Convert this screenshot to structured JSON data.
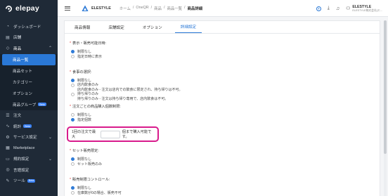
{
  "brand": {
    "name": "elepay"
  },
  "sidebar": {
    "items": [
      {
        "label": "ダッシュボード"
      },
      {
        "label": "店舗"
      },
      {
        "label": "商品"
      },
      {
        "label": "注文"
      },
      {
        "label": "統計",
        "badge": "Beta"
      },
      {
        "label": "サービス設定"
      },
      {
        "label": "Marketplace"
      },
      {
        "label": "規約設定"
      },
      {
        "label": "言語設定"
      },
      {
        "label": "ツール",
        "badge": "Beta"
      }
    ],
    "product_sub": [
      {
        "label": "商品一覧"
      },
      {
        "label": "商品セット"
      },
      {
        "label": "カテゴリー"
      },
      {
        "label": "オプション"
      },
      {
        "label": "商品グループ",
        "badge": "Beta"
      }
    ]
  },
  "header": {
    "store_name": "ELESTYLE",
    "breadcrumb": [
      "ホーム",
      "OneQR",
      "商品",
      "商品一覧",
      "商品詳細"
    ],
    "user_name": "ELESTYLE",
    "user_sub": "ELESTYLE株式会社(エ..."
  },
  "tabs": [
    "商品情報",
    "店舗設定",
    "オプション",
    "詳細設定"
  ],
  "sections": {
    "display_period": {
      "title": "表示・販売可能日時:",
      "options": [
        "制限なし",
        "指定日時に表示"
      ]
    },
    "dining": {
      "title": "食事の選択:",
      "options": [
        {
          "label": "制限なし"
        },
        {
          "label": "店内飲食のみ",
          "desc": "店内飲食のみ - 注文は店内での飲食に限定され、持ち帰りは不可。"
        },
        {
          "label": "持ち帰りのみ",
          "desc": "持ち帰りのみ - 注文は持ち帰り専用で、店内飲食は不可。"
        }
      ]
    },
    "purchase_limit": {
      "title": "注文ごとの商品購入個数制限:",
      "options": [
        "制限なし",
        "指定個数"
      ],
      "prefix": "1回の注文で最大",
      "suffix": "個まで購入可能です。"
    },
    "set_sale": {
      "title": "セット販売限定:",
      "options": [
        "制限なし",
        "セット販売のみ"
      ]
    },
    "sale_control": {
      "title": "販売制限コントロール:",
      "options": [
        "制限なし",
        "在庫数が0の場合、販売不可"
      ]
    }
  },
  "colors": {
    "accent": "#2a78d6",
    "highlight": "#d81b8c",
    "sidebar": "#1f2a37"
  }
}
